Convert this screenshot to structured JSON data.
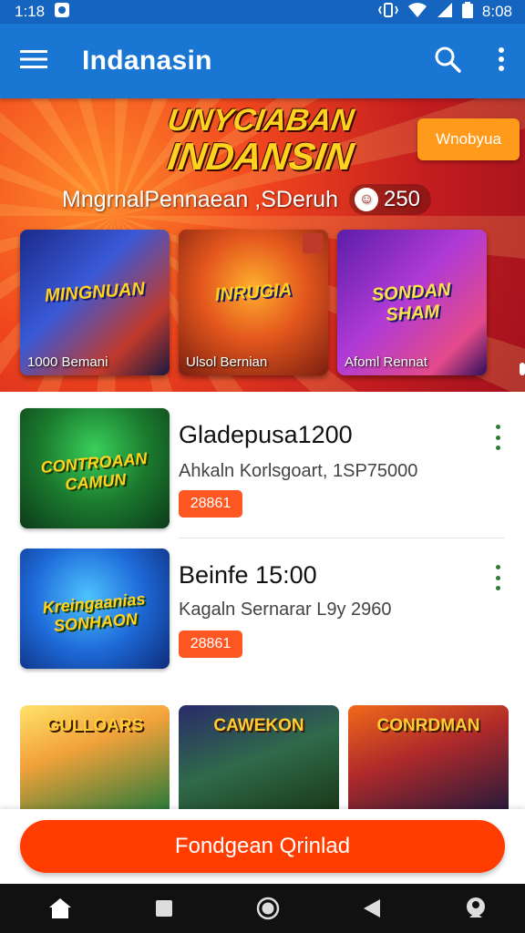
{
  "status_bar": {
    "time_left": "1:18",
    "time_right": "8:08"
  },
  "app_bar": {
    "title": "Indanasin"
  },
  "hero": {
    "logo_line1": "UNYCIABAN",
    "logo_line2": "INDANSIN",
    "cta_label": "Wnobyua",
    "subtitle": "MngrnalPennaean ,SDeruh",
    "coins": "250",
    "cards": [
      {
        "art_title": "MINGNUAN",
        "label": "1000 Bemani"
      },
      {
        "art_title": "INRUGIA",
        "label": "Ulsol Bernian"
      },
      {
        "art_title": "SONDAN SHAM",
        "label": "Afoml Rennat"
      }
    ]
  },
  "list": [
    {
      "art_title": "CONTROAAN CAMUN",
      "name": "Gladepusa1200",
      "meta": "Ahkaln Korlsgoart, 1SP75000",
      "tag": "28861"
    },
    {
      "art_title": "Kreingaanias SONHAON",
      "name": "Beinfe 15:00",
      "meta": "Kagaln Sernarar L9y 2960",
      "tag": "28861"
    }
  ],
  "grid": [
    {
      "art_title": "GULLOARS"
    },
    {
      "art_title": "CAWEKON"
    },
    {
      "art_title": "CONRDMAN"
    }
  ],
  "main_button": {
    "label": "Fondgean Qrinlad"
  },
  "colors": {
    "app_bar": "#1976d2",
    "status_bar": "#1565c0",
    "accent": "#ff3d00",
    "tag": "#ff5722",
    "more_dots": "#2e7d32"
  }
}
